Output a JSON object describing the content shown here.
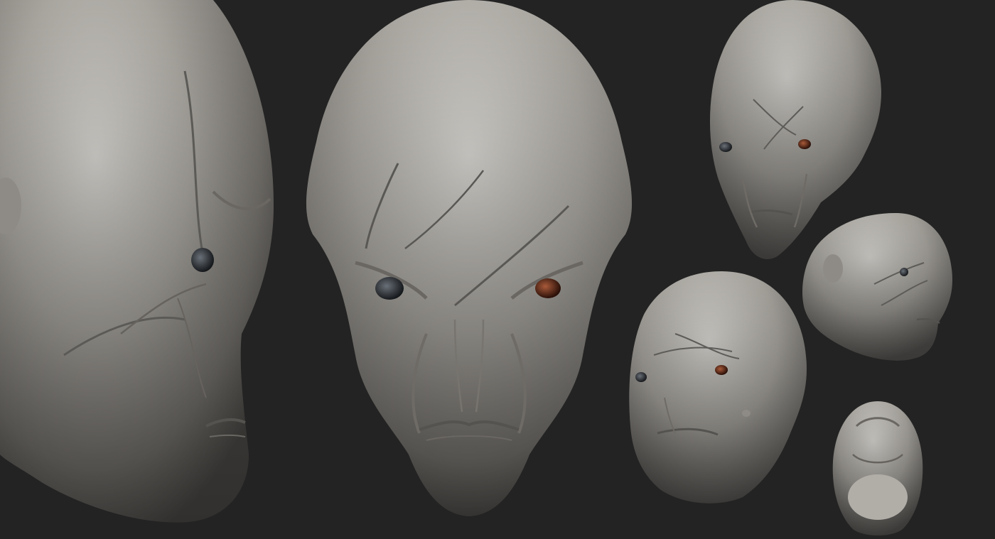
{
  "scene": {
    "background_color": "#232323",
    "subject": "sculpted-alien-head-turnaround",
    "clay_color": "#a6a39d",
    "clay_shadow_color": "#4a4845",
    "clay_highlight_color": "#d9d7d2",
    "views": [
      {
        "name": "side-closeup-view",
        "angle": "three-quarter-left"
      },
      {
        "name": "front-view",
        "angle": "front"
      },
      {
        "name": "top-right-three-quarter-view",
        "angle": "three-quarter"
      },
      {
        "name": "profile-right-view",
        "angle": "profile-right"
      },
      {
        "name": "lower-three-quarter-view",
        "angle": "three-quarter-low"
      },
      {
        "name": "bottom-view",
        "angle": "underside"
      }
    ]
  },
  "eye_colors": {
    "left": "#2e3338",
    "right": "#5a2a1a"
  }
}
